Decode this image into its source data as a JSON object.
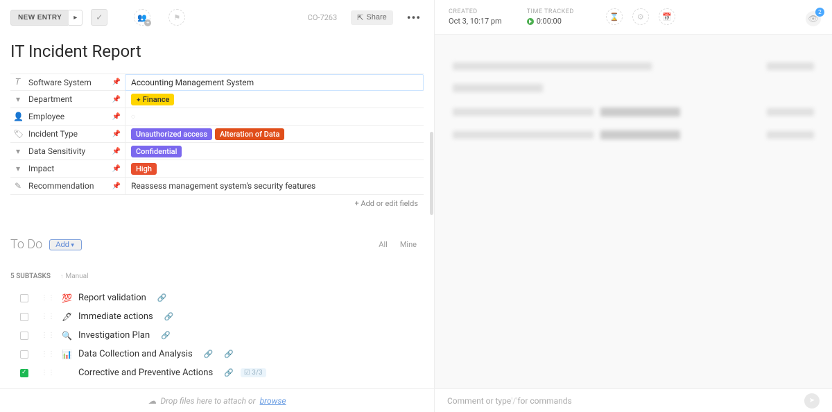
{
  "topbar": {
    "new_entry": "NEW ENTRY",
    "task_id": "CO-7263",
    "share": "Share"
  },
  "title": "IT Incident Report",
  "fields": {
    "software_system": {
      "label": "Software System",
      "value": "Accounting Management System"
    },
    "department": {
      "label": "Department",
      "tag": "Finance"
    },
    "employee": {
      "label": "Employee"
    },
    "incident_type": {
      "label": "Incident Type",
      "tag1": "Unauthorized access",
      "tag2": "Alteration of Data"
    },
    "data_sensitivity": {
      "label": "Data Sensitivity",
      "tag": "Confidential"
    },
    "impact": {
      "label": "Impact",
      "tag": "High"
    },
    "recommendation": {
      "label": "Recommendation",
      "value": "Reassess management system's security features"
    },
    "add_edit": "+ Add or edit fields"
  },
  "todo": {
    "title": "To Do",
    "add": "Add",
    "filters": {
      "all": "All",
      "mine": "Mine"
    },
    "subtasks_count": "5 SUBTASKS",
    "sort": "Manual",
    "items": [
      {
        "emoji": "💯",
        "title": "Report validation",
        "checked": false,
        "link": true
      },
      {
        "emoji": "🖊",
        "title": "Immediate actions",
        "checked": false,
        "link": true
      },
      {
        "emoji": "🔍",
        "title": "Investigation Plan",
        "checked": false,
        "link": true
      },
      {
        "emoji": "📊",
        "title": "Data Collection and Analysis",
        "checked": false,
        "link": true,
        "link2": true
      },
      {
        "emoji": "",
        "title": "Corrective and Preventive Actions",
        "checked": true,
        "link": true,
        "badge": "☑ 3/3"
      }
    ]
  },
  "right": {
    "created_label": "CREATED",
    "created_value": "Oct 3, 10:17 pm",
    "time_label": "TIME TRACKED",
    "time_value": "0:00:00",
    "notif_count": "2"
  },
  "bottom": {
    "drop_text": "Drop files here to attach or ",
    "browse": "browse",
    "comment_placeholder_pre": "Comment or type ",
    "comment_placeholder_slash": "'/'",
    "comment_placeholder_post": " for commands"
  }
}
